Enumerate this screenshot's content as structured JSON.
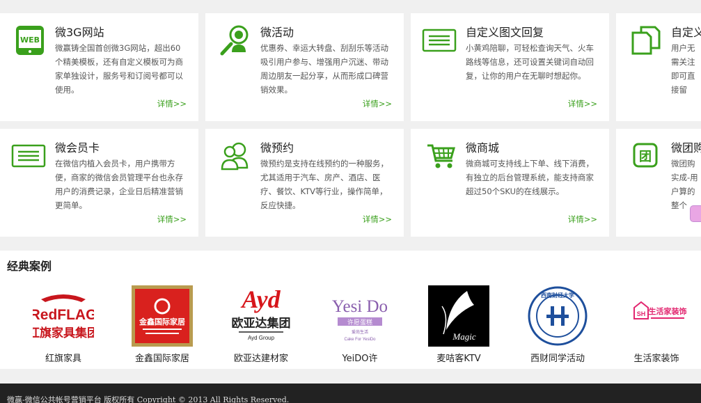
{
  "features": [
    {
      "title": "微3G网站",
      "desc": "微赢铸全国首创微3G网站，超出60个精美模板，还有自定义模板可为商家单独设计，服务号和订阅号都可以使用。",
      "more": "详情>>",
      "icon": "web-phone-icon",
      "icon_text": "WEB"
    },
    {
      "title": "微活动",
      "desc": "优惠券、幸运大转盘、刮刮乐等活动吸引用户参与、增强用户沉迷、带动周边朋友一起分享，从而形成口碑营销效果。",
      "more": "详情>>",
      "icon": "user-search-icon"
    },
    {
      "title": "自定义图文回复",
      "desc": "小黄鸡陪聊，可轻松查询天气、火车路线等信息，还可设置关键词自动回复，让你的用户在无聊时想起你。",
      "more": "详情>>",
      "icon": "message-lines-icon"
    },
    {
      "title": "自定义",
      "desc": "用户无需关注即可直接留言，并能让商家丝更好",
      "more": "",
      "icon": "copy-docs-icon"
    },
    {
      "title": "微会员卡",
      "desc": "在微信内植入会员卡，用户携带方便，商家的微信会员管理平台也永存用户的消费记录，企业日后精准营销更简单。",
      "more": "详情>>",
      "icon": "card-icon"
    },
    {
      "title": "微预约",
      "desc": "微预约是支持在线预约的一种服务，尤其适用于汽车、房产、酒店、医疗、餐饮、KTV等行业，操作简单，反应快捷。",
      "more": "详情>>",
      "icon": "users-icon"
    },
    {
      "title": "微商城",
      "desc": "微商城可支持线上下单、线下消费，有独立的后台管理系统，能支持商家超过50个SKU的在线展示。",
      "more": "详情>>",
      "icon": "cart-icon"
    },
    {
      "title": "微团购",
      "desc": "微团购实成-用户算的整个订、线下",
      "more": "",
      "icon": "group-buy-icon",
      "icon_text": "团"
    }
  ],
  "cases": {
    "title": "经典案例",
    "items": [
      {
        "name": "红旗家具",
        "logo": "redflag-logo"
      },
      {
        "name": "金鑫国际家居",
        "logo": "jinxin-logo"
      },
      {
        "name": "欧亚达建材家",
        "logo": "ayd-logo"
      },
      {
        "name": "YeiDO许",
        "logo": "yesido-logo"
      },
      {
        "name": "麦咭客KTV",
        "logo": "magic-logo"
      },
      {
        "name": "西财同学活动",
        "logo": "xicai-logo"
      },
      {
        "name": "生活家装饰",
        "logo": "shenghuojia-logo"
      }
    ]
  },
  "footer": {
    "text": "微赢-微信公共帐号营销平台 版权所有 Copyright © 2013 All Rights Reserved."
  },
  "colors": {
    "accent": "#3aa01c",
    "footer_bg": "#222222",
    "page_bg": "#f0f0f0"
  }
}
